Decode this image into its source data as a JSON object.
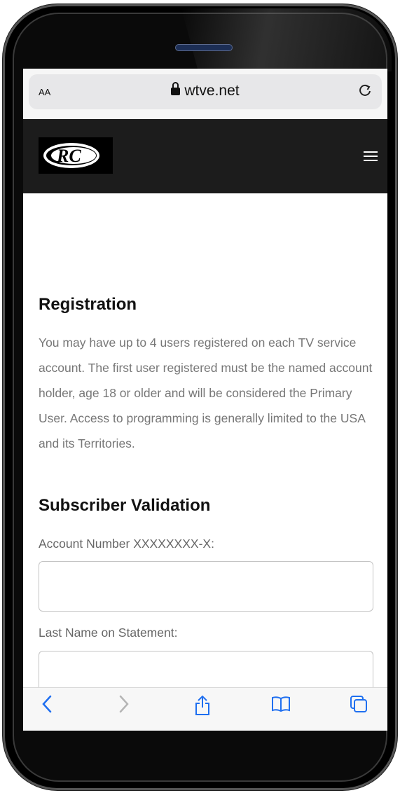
{
  "browser": {
    "text_size_label": "AA",
    "url": "wtve.net",
    "lock_icon": "lock-icon",
    "reload_icon": "reload-icon"
  },
  "site": {
    "logo_text": "RC",
    "menu_icon": "hamburger-icon"
  },
  "page": {
    "registration_heading": "Registration",
    "registration_text": "You may have up to 4 users registered on each TV service account. The first user registered must be the named account holder, age 18 or older and will be considered the Primary User. Access to programming is generally limited to the USA and its Territories.",
    "validation_heading": "Subscriber Validation",
    "account_label": "Account Number XXXXXXXX-X:",
    "account_value": "",
    "lastname_label": "Last Name on Statement:",
    "lastname_value": ""
  },
  "toolbar": {
    "back_glyph": "‹",
    "forward_glyph": "›",
    "share_icon": "share-icon",
    "bookmarks_icon": "book-icon",
    "tabs_icon": "tabs-icon"
  },
  "colors": {
    "accent": "#1f6ff0",
    "header_bg": "#1c1c1c"
  }
}
